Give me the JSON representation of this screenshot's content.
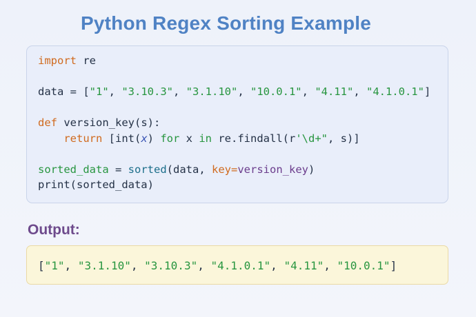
{
  "title": "Python Regex Sorting Example",
  "code": {
    "l1_kw": "import",
    "l1_rest": " re",
    "l2_a": "data = [",
    "l2_s1": "\"1\"",
    "l2_s2": "\"3.10.3\"",
    "l2_s3": "\"3.1.10\"",
    "l2_s4": "\"10.0.1\"",
    "l2_s5": "\"4.11\"",
    "l2_s6": "\"4.1.0.1\"",
    "sep": ", ",
    "close": "]",
    "l3_kw": "def",
    "l3_rest": " version_key(s):",
    "l4_indent": "    ",
    "l4_kw": "return",
    "l4_a": " [int(",
    "l4_x": "x",
    "l4_b": ") ",
    "l4_for": "for",
    "l4_c": " x ",
    "l4_in": "in",
    "l4_d": " re.findall(r",
    "l4_pat": "'\\d+\"",
    "l4_e": ", s)]",
    "l5_a": "sorted_data",
    "l5_b": " = ",
    "l5_c": "sorted",
    "l5_d": "(data, ",
    "l5_e": "key",
    "l5_f": "=",
    "l5_g": "version_key",
    "l5_h": ")",
    "l6": "print(sorted_data)"
  },
  "output_label": "Output:",
  "output": {
    "open": "[",
    "o1": "\"1\"",
    "o2": "\"3.1.10\"",
    "o3": "\"3.10.3\"",
    "o4": "\"4.1.0.1\"",
    "o5": "\"4.11\"",
    "o6": "\"10.0.1\"",
    "sep": ", ",
    "close": "]"
  },
  "colors": {
    "title": "#4f82c4",
    "keyword": "#d06a1e",
    "string": "#27953f",
    "output_label": "#6e4a8c",
    "code_bg": "#e9eefa",
    "output_bg": "#fbf6da"
  }
}
